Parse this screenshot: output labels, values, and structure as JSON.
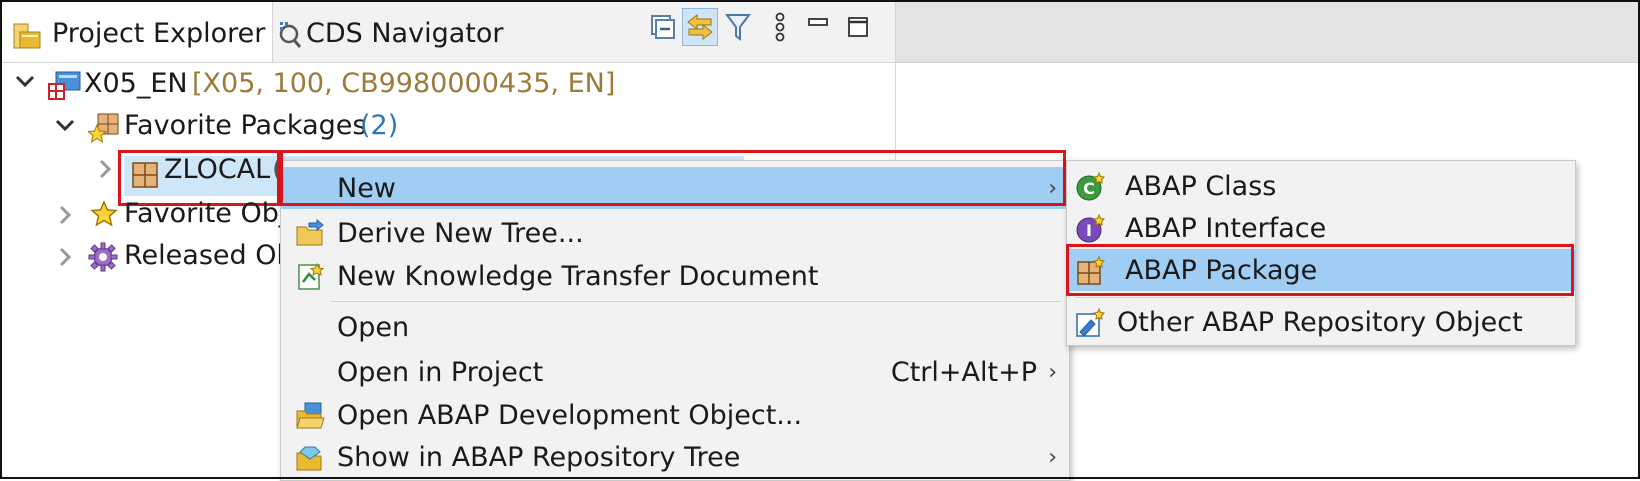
{
  "tabs": {
    "project_explorer": "Project Explorer",
    "cds_navigator": "CDS Navigator"
  },
  "toolbar": {
    "collapse_all": "collapse-all-icon",
    "link_with_editor": "link-with-editor-icon",
    "filter": "filter-icon",
    "view_menu": "view-menu-icon",
    "minimize": "minimize-icon",
    "maximize": "maximize-icon"
  },
  "tree": {
    "project_name": "X05_EN",
    "project_info": "[X05, 100, CB9980000435, EN]",
    "favorite_packages": "Favorite Packages",
    "favorite_packages_count": "(2)",
    "zlocal": "ZLOCAL",
    "zlocal_suffix": "(",
    "favorite_objects": "Favorite Obj",
    "released_objects": "Released Ob"
  },
  "context_menu": {
    "new": "New",
    "derive_new_tree": "Derive New Tree...",
    "new_ktd": "New Knowledge Transfer Document",
    "open": "Open",
    "open_in_project": "Open in Project",
    "open_in_project_shortcut": "Ctrl+Alt+P",
    "open_abap_dev_object": "Open ABAP Development Object...",
    "show_in_repo_tree": "Show in ABAP Repository Tree"
  },
  "submenu": {
    "abap_class": "ABAP Class",
    "abap_interface": "ABAP Interface",
    "abap_package": "ABAP Package",
    "other_repo_object": "Other ABAP Repository Object"
  },
  "colors": {
    "highlight": "#9fcdf3",
    "annotation_red": "#d9141c",
    "project_info": "#9b7a3a",
    "count_blue": "#2a78b8"
  }
}
